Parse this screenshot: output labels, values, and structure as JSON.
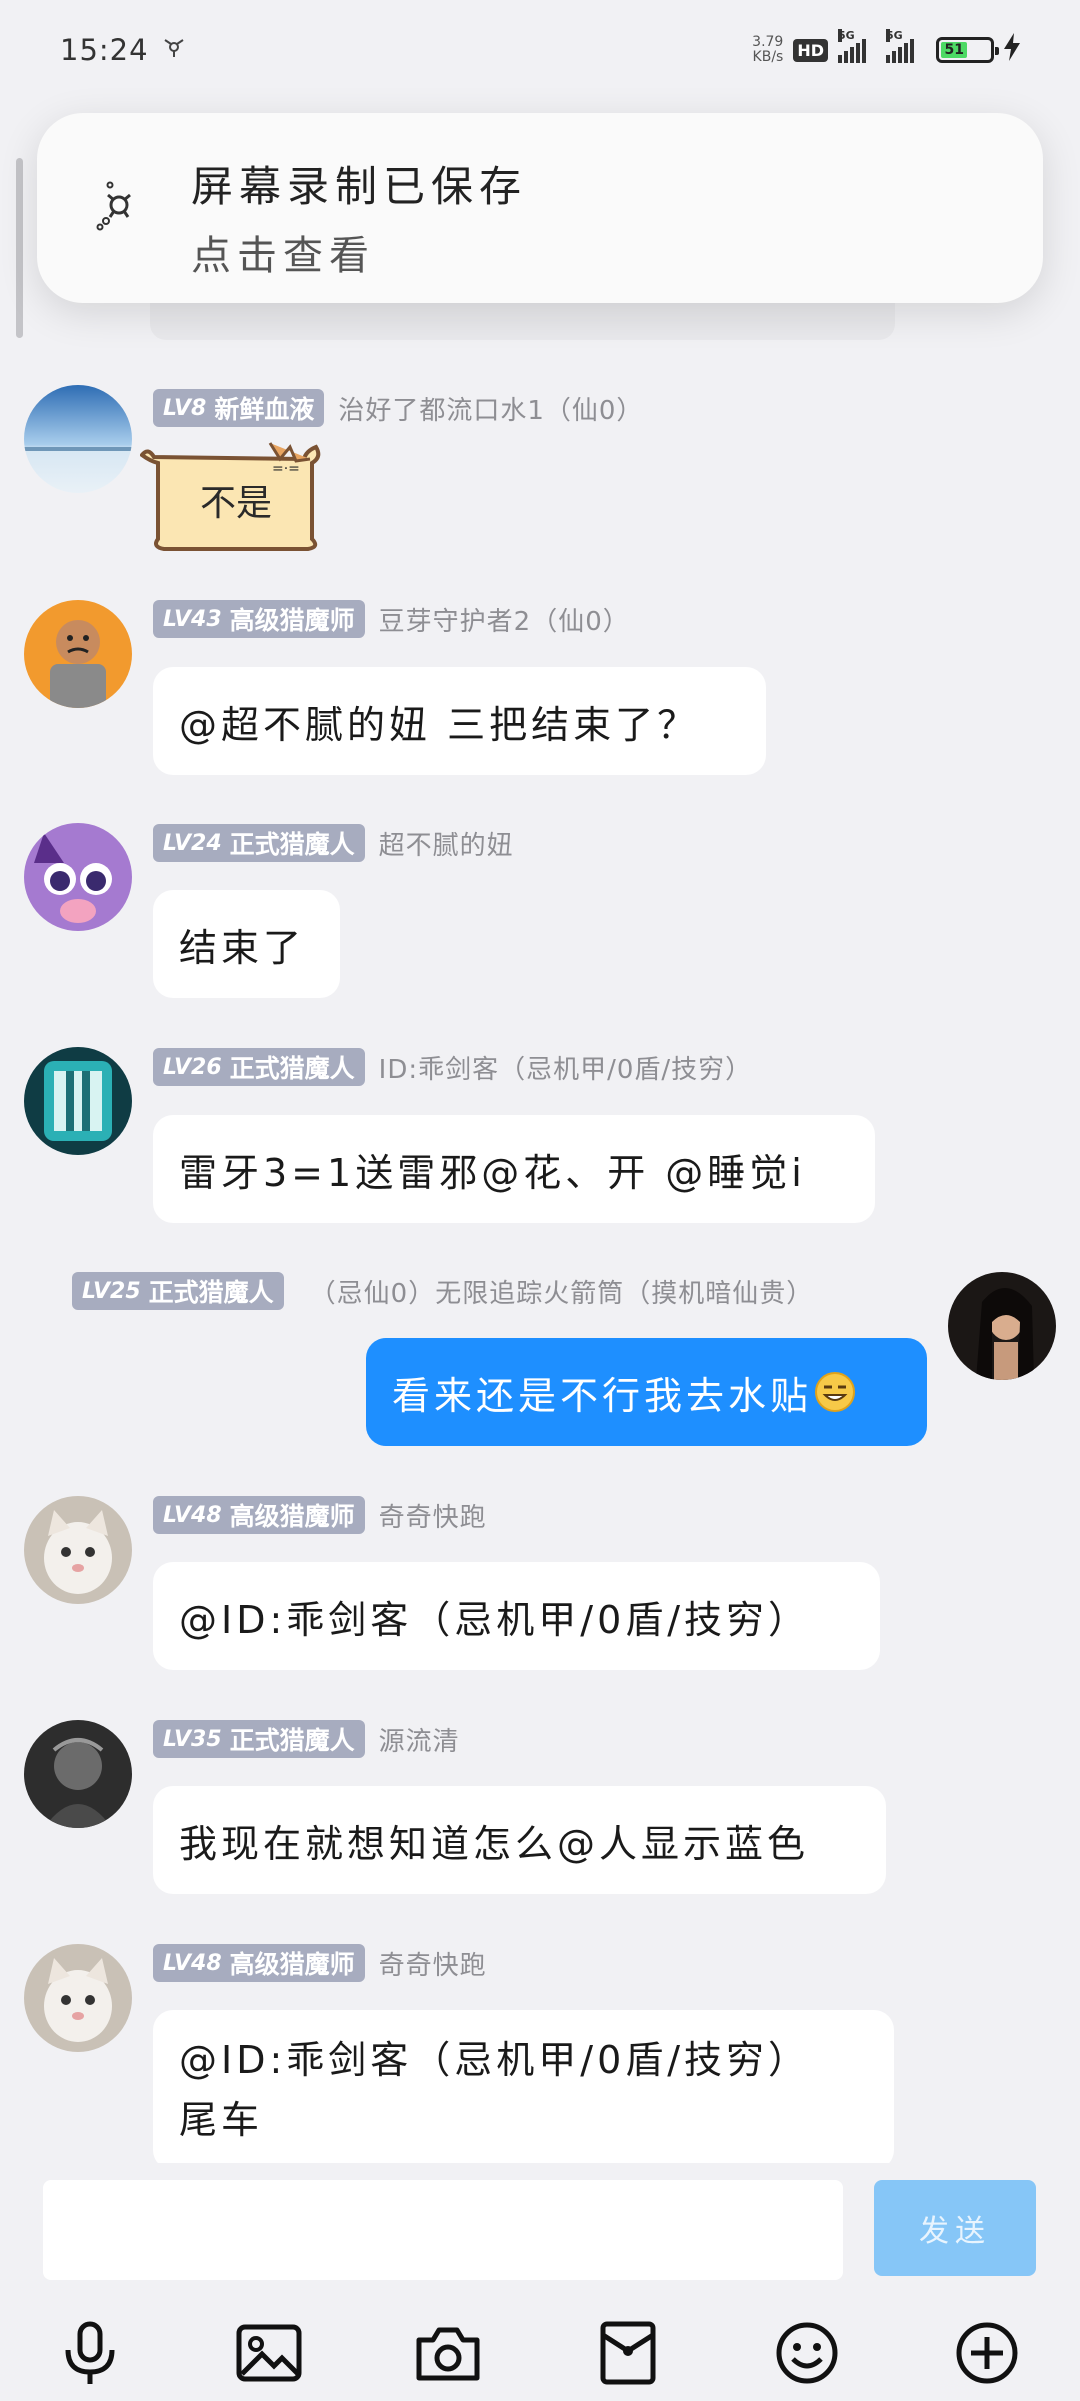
{
  "status_bar": {
    "time": "15:24",
    "net_speed_value": "3.79",
    "net_speed_unit": "KB/s",
    "hd": "HD",
    "sig1": "5G",
    "sig2": "5G",
    "battery": "51"
  },
  "notification": {
    "title": "屏幕录制已保存",
    "subtitle": "点击查看"
  },
  "messages": [
    {
      "level": "LV8",
      "title": "新鲜血液",
      "nickname": "治好了都流口水1（仙0）",
      "text": "",
      "sticker_text": "不是"
    },
    {
      "level": "LV43",
      "title": "高级猎魔师",
      "nickname": "豆芽守护者2（仙0）",
      "text": "@超不腻的妞 三把结束了？"
    },
    {
      "level": "LV24",
      "title": "正式猎魔人",
      "nickname": "超不腻的妞",
      "text": "结束了"
    },
    {
      "level": "LV26",
      "title": "正式猎魔人",
      "nickname": "ID:乖剑客（忌机甲/0盾/技穷）",
      "text": "雷牙3=1送雷邪@花、开 @睡觉i"
    },
    {
      "level": "LV25",
      "title": "正式猎魔人",
      "nickname": "（忌仙0）无限追踪火箭筒（摸机暗仙贵）",
      "text": "看来还是不行我去水贴"
    },
    {
      "level": "LV48",
      "title": "高级猎魔师",
      "nickname": "奇奇快跑",
      "text": "@ID:乖剑客（忌机甲/0盾/技穷）"
    },
    {
      "level": "LV35",
      "title": "正式猎魔人",
      "nickname": "源流清",
      "text": "我现在就想知道怎么@人显示蓝色"
    },
    {
      "level": "LV48",
      "title": "高级猎魔师",
      "nickname": "奇奇快跑",
      "text_line1": "@ID:乖剑客（忌机甲/0盾/技穷）",
      "text_line2": "尾车"
    }
  ],
  "input": {
    "value": "",
    "send_label": "发送"
  },
  "toolbar_icons": [
    "microphone-icon",
    "image-icon",
    "camera-icon",
    "red-packet-icon",
    "emoji-icon",
    "plus-icon"
  ],
  "colors": {
    "background": "#f1f1f4",
    "level_badge": "#a7acbf",
    "own_bubble": "#1e8fff",
    "send_button": "#86c6f7"
  }
}
